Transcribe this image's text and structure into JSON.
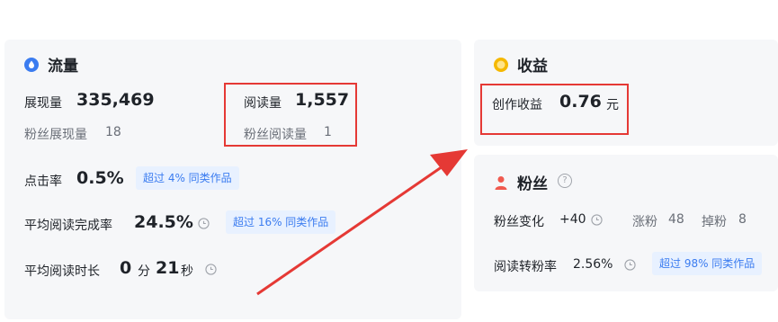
{
  "traffic": {
    "title": "流量",
    "impressions_label": "展现量",
    "impressions_value": "335,469",
    "fan_impressions_label": "粉丝展现量",
    "fan_impressions_value": "18",
    "reads_label": "阅读量",
    "reads_value": "1,557",
    "fan_reads_label": "粉丝阅读量",
    "fan_reads_value": "1",
    "ctr_label": "点击率",
    "ctr_value": "0.5%",
    "ctr_badge": "超过 4% 同类作品",
    "completion_label": "平均阅读完成率",
    "completion_value": "24.5%",
    "completion_badge": "超过 16% 同类作品",
    "duration_label": "平均阅读时长",
    "duration_min": "0",
    "duration_min_unit": "分",
    "duration_sec": "21",
    "duration_sec_unit": "秒"
  },
  "income": {
    "title": "收益",
    "creation_label": "创作收益",
    "creation_value": "0.76",
    "creation_unit": "元"
  },
  "fans": {
    "title": "粉丝",
    "change_label": "粉丝变化",
    "change_value": "+40",
    "gain_label": "涨粉",
    "gain_value": "48",
    "loss_label": "掉粉",
    "loss_value": "8",
    "conversion_label": "阅读转粉率",
    "conversion_value": "2.56%",
    "conversion_badge": "超过 98% 同类作品"
  },
  "colors": {
    "highlight_box": "#e53935",
    "arrow": "#e53935",
    "badge_bg": "#e8f1ff",
    "badge_text": "#3b7cf0",
    "traffic_icon": "#3b7cf0",
    "income_icon": "#f5b800",
    "fans_icon": "#f05a4f"
  }
}
